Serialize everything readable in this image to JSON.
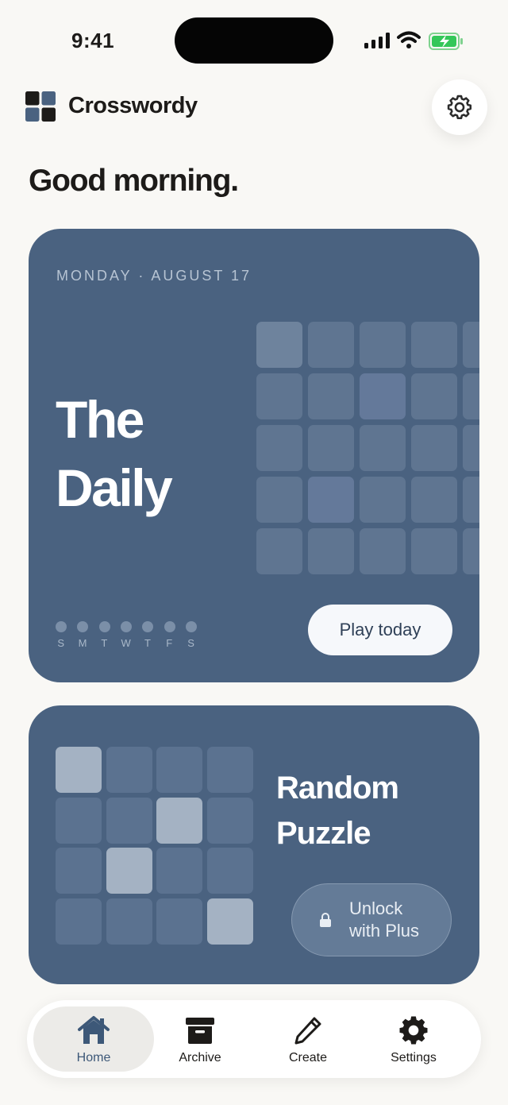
{
  "status_bar": {
    "time": "9:41"
  },
  "header": {
    "app_title": "Crosswordy",
    "settings_icon": "gear-icon"
  },
  "greeting": "Good morning.",
  "daily_card": {
    "date": "MONDAY · AUGUST 17",
    "title_line1": "The",
    "title_line2": "Daily",
    "week_days": [
      "S",
      "M",
      "T",
      "W",
      "T",
      "F",
      "S"
    ],
    "play_label": "Play today"
  },
  "random_card": {
    "title_line1": "Random",
    "title_line2": "Puzzle",
    "unlock_line1": "Unlock",
    "unlock_line2": "with Plus",
    "unlock_icon": "lock-icon"
  },
  "tab_bar": {
    "tabs": [
      {
        "label": "Home",
        "icon": "home-icon",
        "active": true
      },
      {
        "label": "Archive",
        "icon": "archive-icon",
        "active": false
      },
      {
        "label": "Create",
        "icon": "pencil-icon",
        "active": false
      },
      {
        "label": "Settings",
        "icon": "gear-icon",
        "active": false
      }
    ]
  },
  "colors": {
    "background": "#f9f8f5",
    "card": "#4a6280",
    "accent": "#3d5878",
    "battery": "#34c759"
  }
}
